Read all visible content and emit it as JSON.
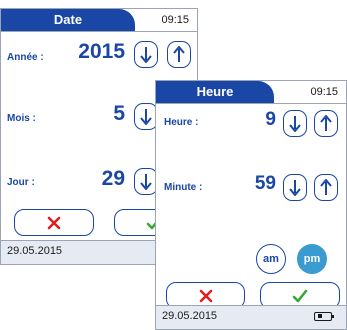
{
  "date_screen": {
    "title": "Date",
    "clock": "09:15",
    "rows": [
      {
        "label": "Année :",
        "value": "2015"
      },
      {
        "label": "Mois :",
        "value": "5"
      },
      {
        "label": "Jour :",
        "value": "29"
      }
    ],
    "status_date": "29.05.2015"
  },
  "time_screen": {
    "title": "Heure",
    "clock": "09:15",
    "rows": [
      {
        "label": "Heure :",
        "value": "9"
      },
      {
        "label": "Minute :",
        "value": "59"
      }
    ],
    "am_label": "am",
    "pm_label": "pm",
    "status_date": "29.05.2015"
  },
  "icons": {
    "down": "arrow-down-icon",
    "up": "arrow-up-icon",
    "cancel": "cross-icon",
    "confirm": "checkmark-icon",
    "battery": "battery-icon"
  },
  "colors": {
    "primary_blue": "#1a47a6",
    "cancel_red": "#e02020",
    "confirm_green": "#3aa639",
    "pm_selected": "#3a9bd0"
  }
}
